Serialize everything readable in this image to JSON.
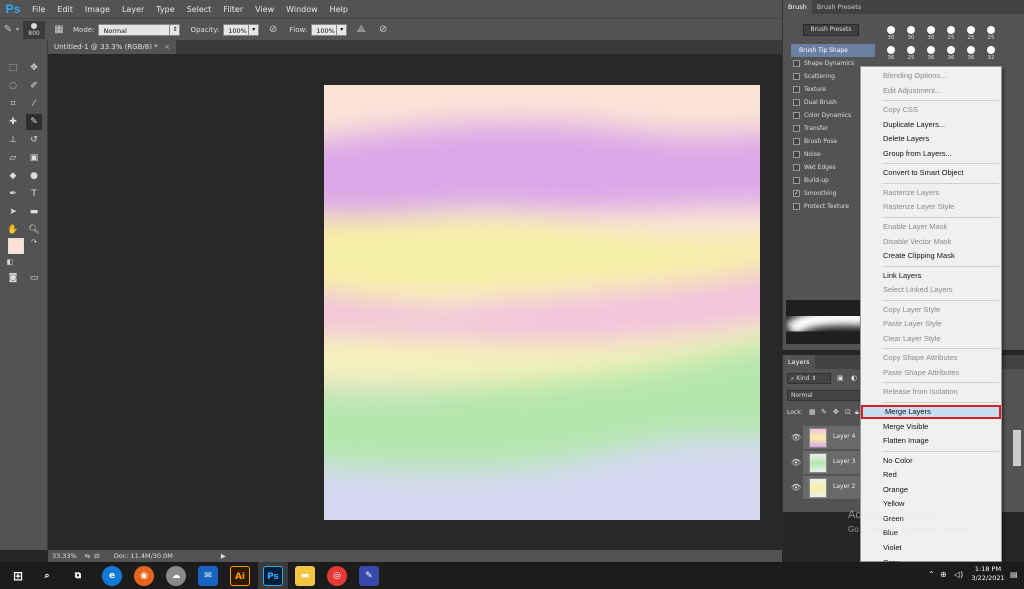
{
  "app": {
    "logo": "Ps"
  },
  "menu": [
    "File",
    "Edit",
    "Image",
    "Layer",
    "Type",
    "Select",
    "Filter",
    "View",
    "Window",
    "Help"
  ],
  "options": {
    "brush_size": "800",
    "mode_label": "Mode:",
    "mode_value": "Normal",
    "opacity_label": "Opacity:",
    "opacity_value": "100%",
    "flow_label": "Flow:",
    "flow_value": "100%"
  },
  "document": {
    "tab_title": "Untitled-1 @ 33.3% (RGB/8) *",
    "close": "×"
  },
  "status": {
    "zoom": "33.33%",
    "doc": "Doc: 11.4M/30.0M"
  },
  "brush_panel": {
    "tabs": [
      "Brush",
      "Brush Presets"
    ],
    "presets_button": "Brush Presets",
    "header": "Brush Tip Shape",
    "options": [
      {
        "label": "Shape Dynamics",
        "checked": false
      },
      {
        "label": "Scattering",
        "checked": false
      },
      {
        "label": "Texture",
        "checked": false
      },
      {
        "label": "Dual Brush",
        "checked": false
      },
      {
        "label": "Color Dynamics",
        "checked": false
      },
      {
        "label": "Transfer",
        "checked": false
      },
      {
        "label": "Brush Pose",
        "checked": false
      },
      {
        "label": "Noise",
        "checked": false
      },
      {
        "label": "Wet Edges",
        "checked": false
      },
      {
        "label": "Build-up",
        "checked": false
      },
      {
        "label": "Smoothing",
        "checked": true
      },
      {
        "label": "Protect Texture",
        "checked": false
      }
    ],
    "tip_sizes_row1": [
      "30",
      "30",
      "30",
      "25",
      "25",
      "25"
    ],
    "tip_sizes_row2": [
      "36",
      "25",
      "36",
      "36",
      "36",
      "32"
    ]
  },
  "layers_panel": {
    "title": "Layers",
    "kind": "Kind",
    "blend": "Normal",
    "lock_label": "Lock:",
    "layers": [
      "Layer 4",
      "Layer 3",
      "Layer 2"
    ]
  },
  "context_menu": {
    "items": [
      {
        "label": "Blending Options...",
        "disabled": true
      },
      {
        "label": "Edit Adjustment...",
        "disabled": true
      },
      {
        "sep": true
      },
      {
        "label": "Copy CSS",
        "disabled": true
      },
      {
        "label": "Duplicate Layers...",
        "disabled": false
      },
      {
        "label": "Delete Layers",
        "disabled": false
      },
      {
        "label": "Group from Layers...",
        "disabled": false
      },
      {
        "sep": true
      },
      {
        "label": "Convert to Smart Object",
        "disabled": false
      },
      {
        "sep": true
      },
      {
        "label": "Rasterize Layers",
        "disabled": true
      },
      {
        "label": "Rasterize Layer Style",
        "disabled": true
      },
      {
        "sep": true
      },
      {
        "label": "Enable Layer Mask",
        "disabled": true
      },
      {
        "label": "Disable Vector Mask",
        "disabled": true
      },
      {
        "label": "Create Clipping Mask",
        "disabled": false
      },
      {
        "sep": true
      },
      {
        "label": "Link Layers",
        "disabled": false
      },
      {
        "label": "Select Linked Layers",
        "disabled": true
      },
      {
        "sep": true
      },
      {
        "label": "Copy Layer Style",
        "disabled": true
      },
      {
        "label": "Paste Layer Style",
        "disabled": true
      },
      {
        "label": "Clear Layer Style",
        "disabled": true
      },
      {
        "sep": true
      },
      {
        "label": "Copy Shape Attributes",
        "disabled": true
      },
      {
        "label": "Paste Shape Attributes",
        "disabled": true
      },
      {
        "sep": true
      },
      {
        "label": "Release from Isolation",
        "disabled": true
      },
      {
        "sep": true
      },
      {
        "label": "Merge Layers",
        "disabled": false,
        "highlight": true
      },
      {
        "label": "Merge Visible",
        "disabled": false
      },
      {
        "label": "Flatten Image",
        "disabled": false
      },
      {
        "sep": true
      },
      {
        "label": "No Color",
        "disabled": false
      },
      {
        "label": "Red",
        "disabled": false
      },
      {
        "label": "Orange",
        "disabled": false
      },
      {
        "label": "Yellow",
        "disabled": false
      },
      {
        "label": "Green",
        "disabled": false
      },
      {
        "label": "Blue",
        "disabled": false
      },
      {
        "label": "Violet",
        "disabled": false
      },
      {
        "label": "Gray",
        "disabled": false
      }
    ]
  },
  "watermark": {
    "title": "Activate Windows",
    "subtitle": "Go to Settings to activate Windows."
  },
  "taskbar": {
    "time": "1:18 PM",
    "date": "3/22/2021"
  },
  "colors": {
    "accent": "#31a8ff",
    "highlight": "#c7dcf0",
    "highlight_border": "#d32020",
    "foreground_swatch": "#fde0d3"
  }
}
